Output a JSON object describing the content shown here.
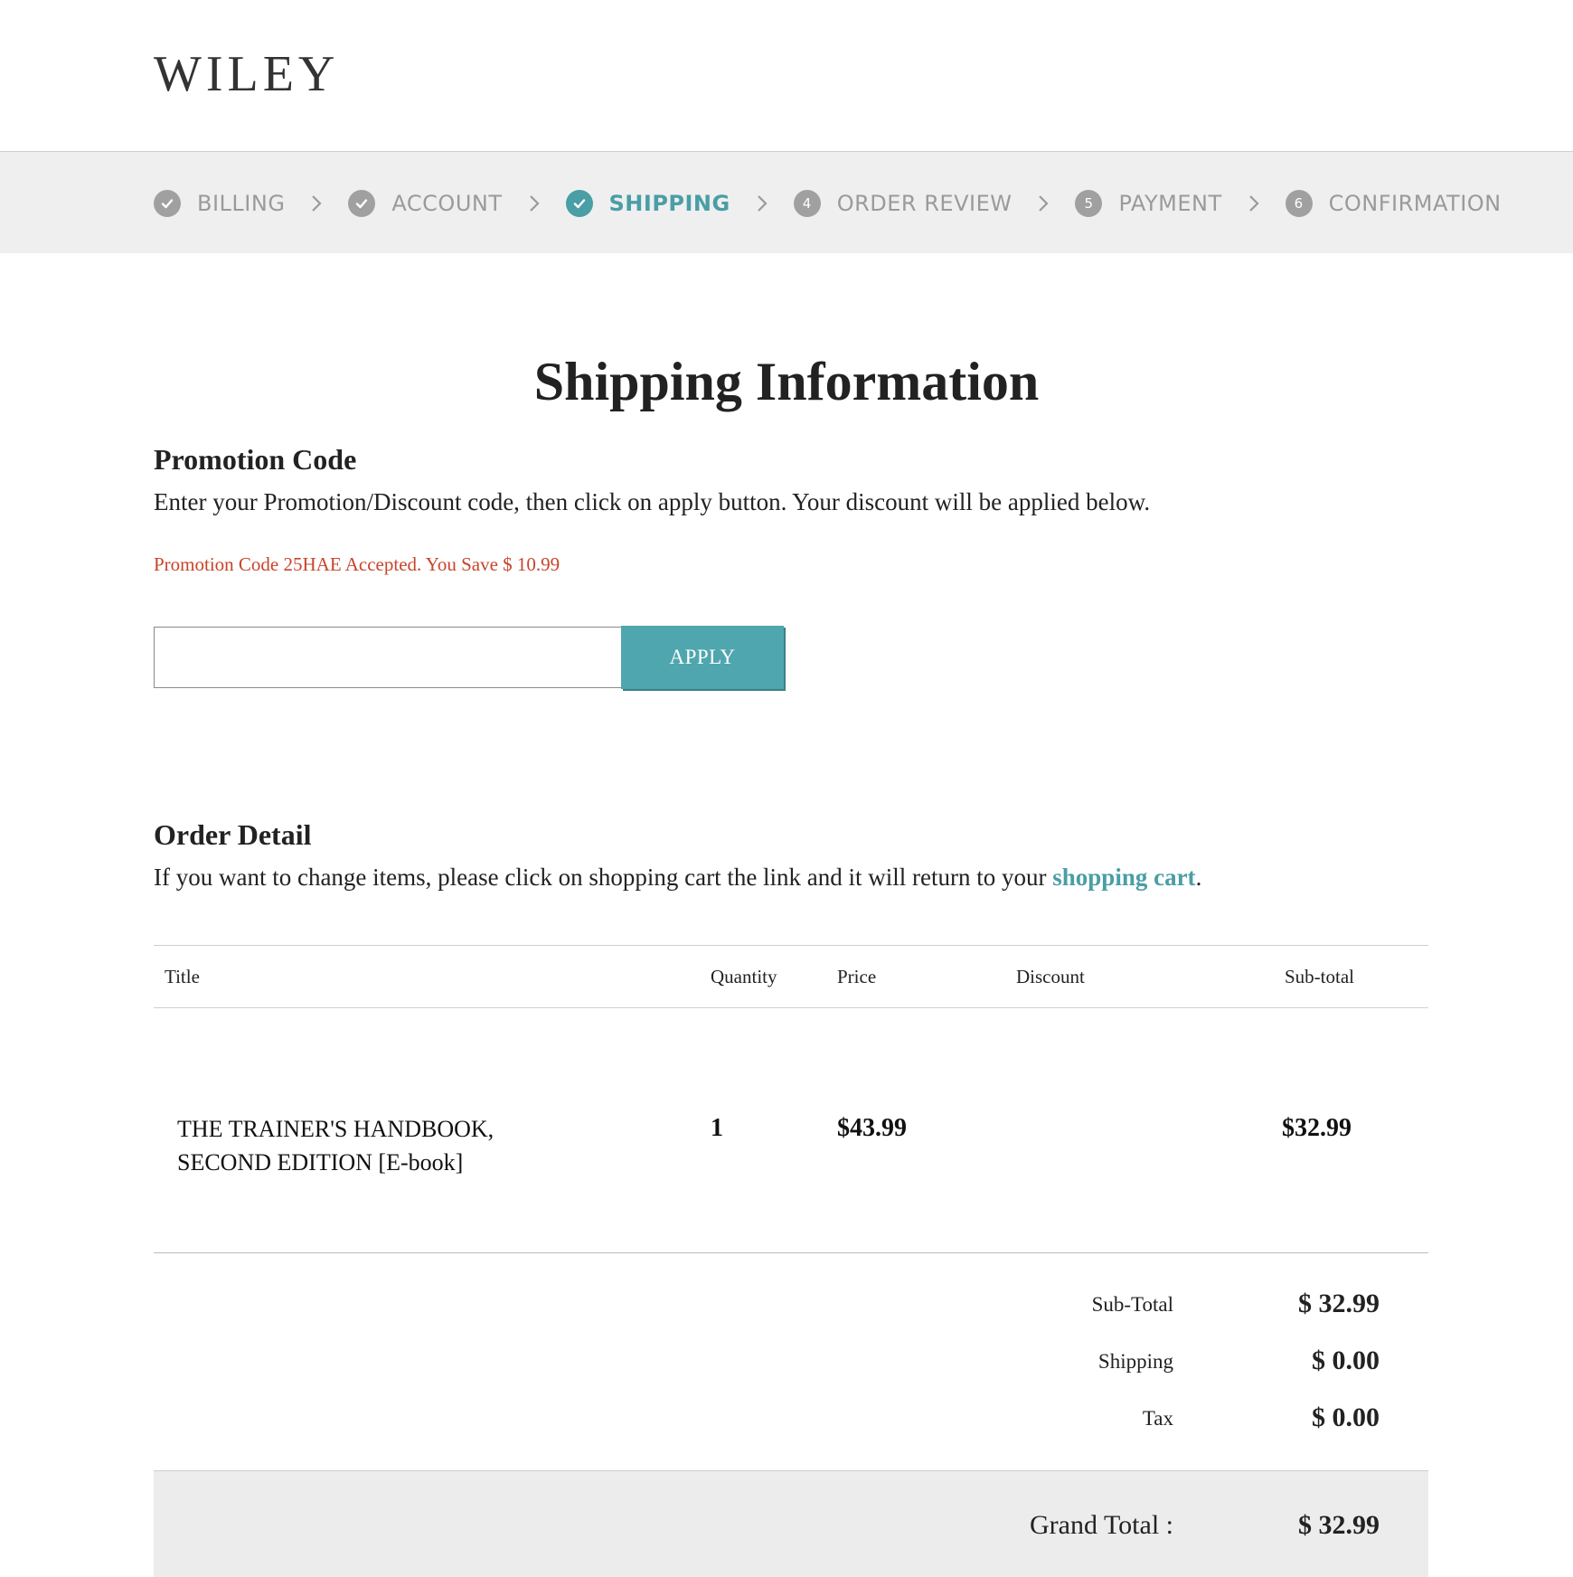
{
  "header": {
    "logo": "WILEY"
  },
  "steps": [
    {
      "number": "",
      "label": "BILLING",
      "state": "done"
    },
    {
      "number": "",
      "label": "ACCOUNT",
      "state": "done"
    },
    {
      "number": "",
      "label": "SHIPPING",
      "state": "active"
    },
    {
      "number": "4",
      "label": "ORDER REVIEW",
      "state": "pending"
    },
    {
      "number": "5",
      "label": "PAYMENT",
      "state": "pending"
    },
    {
      "number": "6",
      "label": "CONFIRMATION",
      "state": "pending"
    }
  ],
  "page": {
    "title": "Shipping Information"
  },
  "promo": {
    "title": "Promotion Code",
    "instructions": "Enter your Promotion/Discount code, then click on apply button. Your discount will be applied below.",
    "message": "Promotion Code 25HAE Accepted. You Save $ 10.99",
    "input_value": "",
    "apply_label": "APPLY"
  },
  "order": {
    "title": "Order Detail",
    "instructions_before": "If you want to change items, please click on shopping cart the link and it will return to your ",
    "cart_link": "shopping cart",
    "instructions_after": ".",
    "columns": {
      "title": "Title",
      "quantity": "Quantity",
      "price": "Price",
      "discount": "Discount",
      "subtotal": "Sub-total"
    },
    "items": [
      {
        "title_line1": "THE TRAINER'S HANDBOOK,",
        "title_line2": "SECOND EDITION [E-book]",
        "quantity": "1",
        "price": "$43.99",
        "discount": "",
        "subtotal": "$32.99"
      }
    ]
  },
  "summary": {
    "subtotal_label": "Sub-Total",
    "subtotal_value": "$ 32.99",
    "shipping_label": "Shipping",
    "shipping_value": "$ 0.00",
    "tax_label": "Tax",
    "tax_value": "$ 0.00",
    "grand_label": "Grand Total :",
    "grand_value": "$ 32.99"
  },
  "colors": {
    "accent": "#4a9ea6",
    "message": "#c8442a",
    "step_inactive": "#9a9a9a",
    "bar_bg": "#efefef"
  }
}
